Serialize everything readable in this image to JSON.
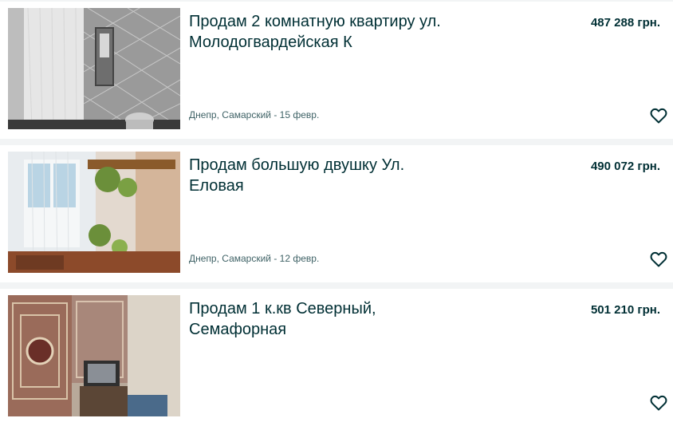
{
  "listings": [
    {
      "title": "Продам 2 комнатную квартиру ул. Молодогвардейская К",
      "price": "487 288 грн.",
      "location_date": "Днепр, Самарский - 15 февр.",
      "photo_icon": "kitchen-photo",
      "favorite_icon": "heart-icon"
    },
    {
      "title": "Продам большую двушку Ул. Еловая",
      "price": "490 072 грн.",
      "location_date": "Днепр, Самарский - 12 февр.",
      "photo_icon": "room-photo",
      "favorite_icon": "heart-icon"
    },
    {
      "title": "Продам 1 к.кв Северный, Семафорная",
      "price": "501 210 грн.",
      "location_date": "",
      "photo_icon": "living-room-photo",
      "favorite_icon": "heart-icon"
    }
  ],
  "colors": {
    "text": "#002f34",
    "meta": "#406367",
    "background": "#f2f4f5",
    "card": "#ffffff"
  }
}
